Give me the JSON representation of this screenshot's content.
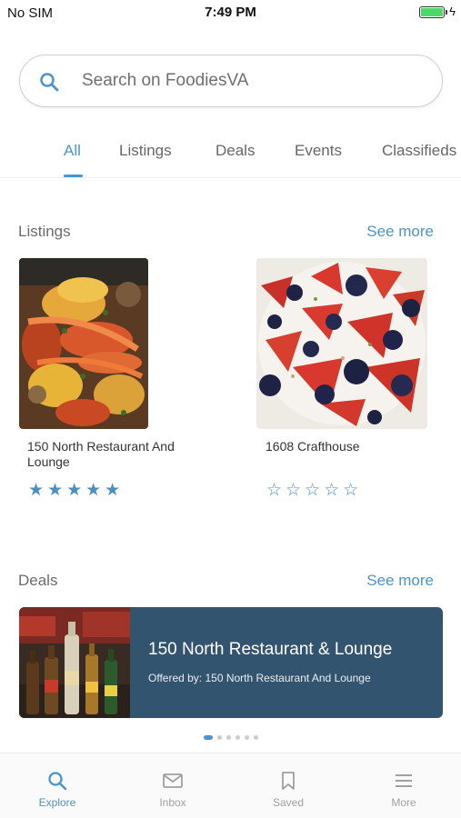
{
  "status": {
    "carrier": "No SIM",
    "time": "7:49 PM",
    "charge_symbol": "ϟ"
  },
  "search": {
    "placeholder": "Search on FoodiesVA"
  },
  "tabs": [
    {
      "label": "All",
      "active": true
    },
    {
      "label": "Listings"
    },
    {
      "label": "Deals"
    },
    {
      "label": "Events"
    },
    {
      "label": "Classifieds"
    }
  ],
  "listings_section": {
    "title": "Listings",
    "see_more": "See more",
    "items": [
      {
        "name": "150 North Restaurant And Lounge",
        "rating": 5,
        "stars": "★★★★★",
        "image": "seafood-boil-photo"
      },
      {
        "name": "1608 Crafthouse",
        "rating": 0,
        "stars": "☆☆☆☆☆",
        "image": "berry-dessert-photo"
      }
    ]
  },
  "deals_section": {
    "title": "Deals",
    "see_more": "See more",
    "deal": {
      "title": "150 North Restaurant & Lounge",
      "subtitle": "Offered by: 150 North Restaurant And Lounge",
      "image": "beer-bottles-photo"
    },
    "pagination": {
      "current": 1,
      "total": 6
    }
  },
  "bottom_nav": [
    {
      "label": "Explore",
      "icon": "search-icon",
      "active": true
    },
    {
      "label": "Inbox",
      "icon": "envelope-icon"
    },
    {
      "label": "Saved",
      "icon": "bookmark-icon"
    },
    {
      "label": "More",
      "icon": "menu-icon"
    }
  ],
  "colors": {
    "accent": "#4a95c9",
    "deal_bg": "#33546e",
    "battery": "#4cd964"
  }
}
